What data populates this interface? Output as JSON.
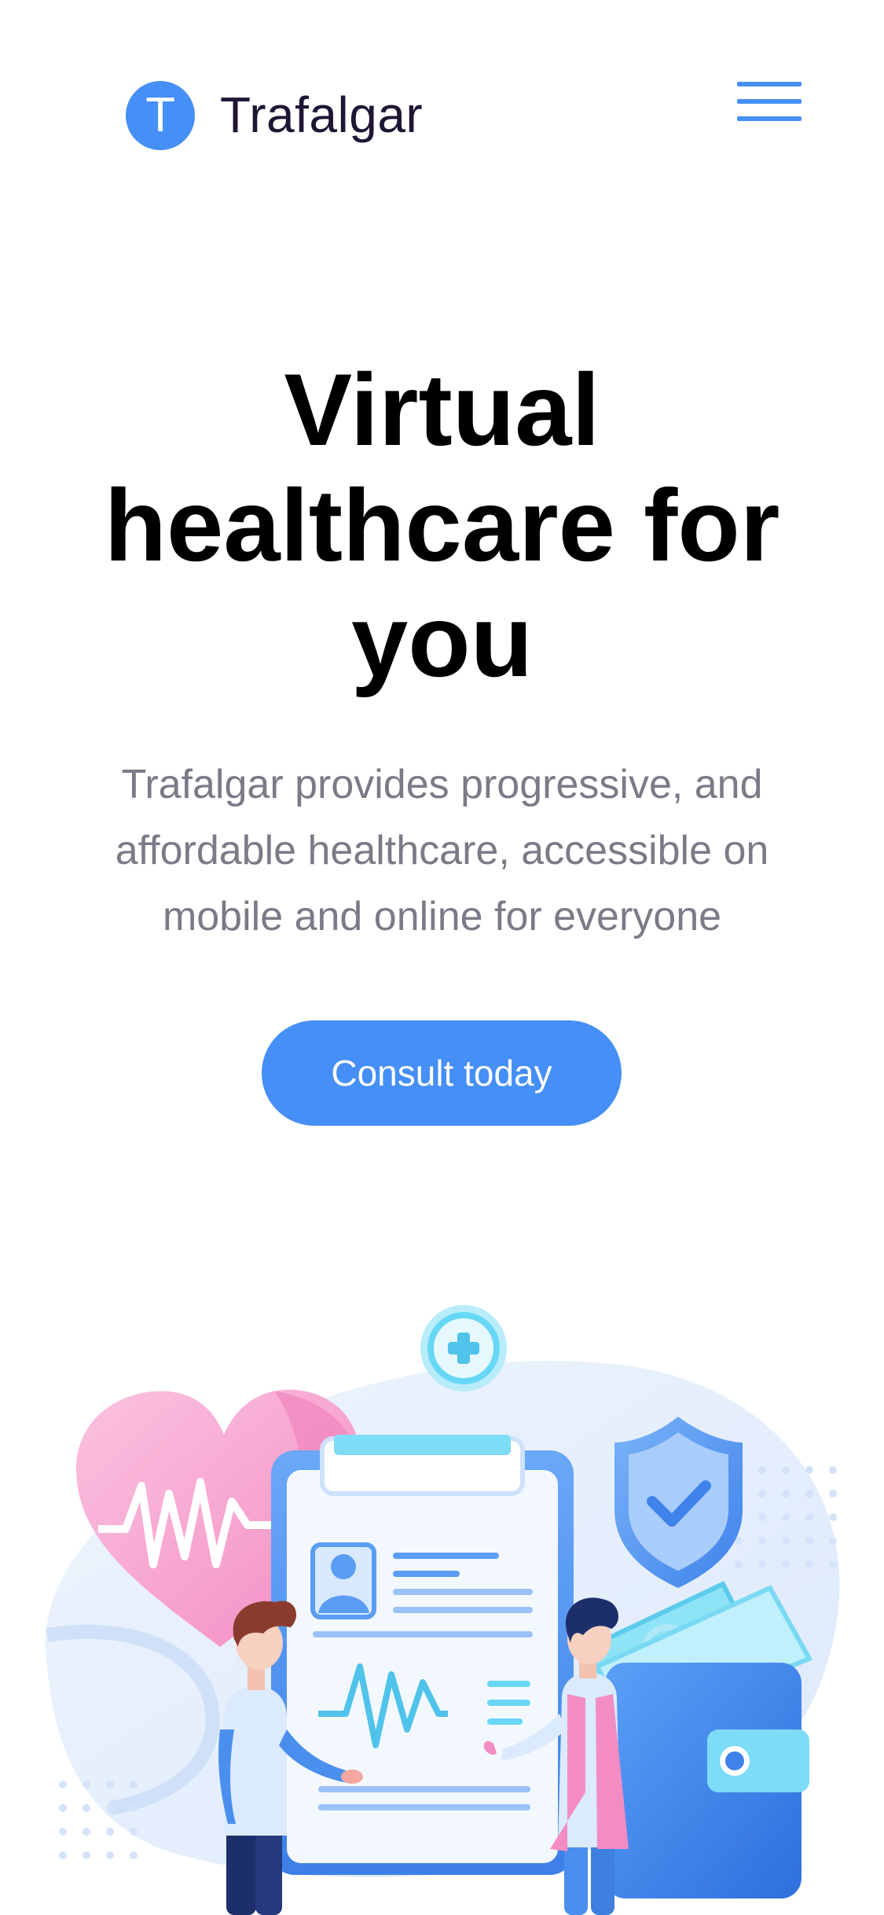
{
  "header": {
    "logo_letter": "T",
    "brand_name": "Trafalgar",
    "menu_icon": "hamburger-menu-icon"
  },
  "hero": {
    "title": "Virtual healthcare for you",
    "description": "Trafalgar provides progressive, and affordable healthcare, accessible on mobile and online for everyone",
    "cta_label": "Consult today"
  },
  "illustration": {
    "icons": [
      "heart-pulse-icon",
      "medical-cross-icon",
      "clipboard-icon",
      "shield-check-icon",
      "wallet-icon",
      "patient-figure",
      "doctor-figure"
    ]
  },
  "colors": {
    "accent": "#458ff6",
    "title": "#000000",
    "body_text": "#7d7987",
    "brand_text": "#1f1534",
    "heart_pink": "#f9a8d4",
    "cyan": "#67d7f5"
  }
}
